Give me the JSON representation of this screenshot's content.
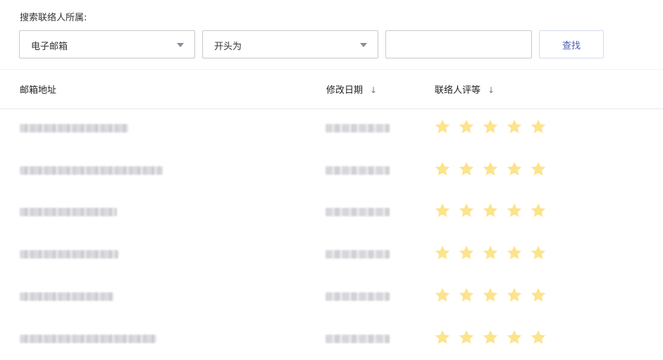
{
  "search": {
    "title": "搜索联络人所属:",
    "field_select": "电子邮箱",
    "operator_select": "开头为",
    "input_value": "",
    "input_placeholder": "",
    "button_label": "查找"
  },
  "table": {
    "columns": [
      {
        "label": "邮箱地址",
        "sort": ""
      },
      {
        "label": "修改日期",
        "sort": "↓"
      },
      {
        "label": "联络人评等",
        "sort": "↓"
      }
    ],
    "rows": [
      {
        "email": "[blurred]",
        "date": "[blurred]",
        "rating": 5
      },
      {
        "email": "[blurred]",
        "date": "[blurred]",
        "rating": 5
      },
      {
        "email": "[blurred]",
        "date": "[blurred]",
        "rating": 5
      },
      {
        "email": "[blurred]",
        "date": "[blurred]",
        "rating": 5
      },
      {
        "email": "[blurred]",
        "date": "[blurred]",
        "rating": 5
      },
      {
        "email": "[blurred]",
        "date": "[blurred]",
        "rating": 5
      }
    ]
  },
  "colors": {
    "star": "#fde38a",
    "button_text": "#4a5bb6",
    "border": "#c9c9cc"
  },
  "icons": {
    "select_arrow": "caret-down-icon",
    "sort": "arrow-down-icon",
    "rating": "star-icon"
  }
}
